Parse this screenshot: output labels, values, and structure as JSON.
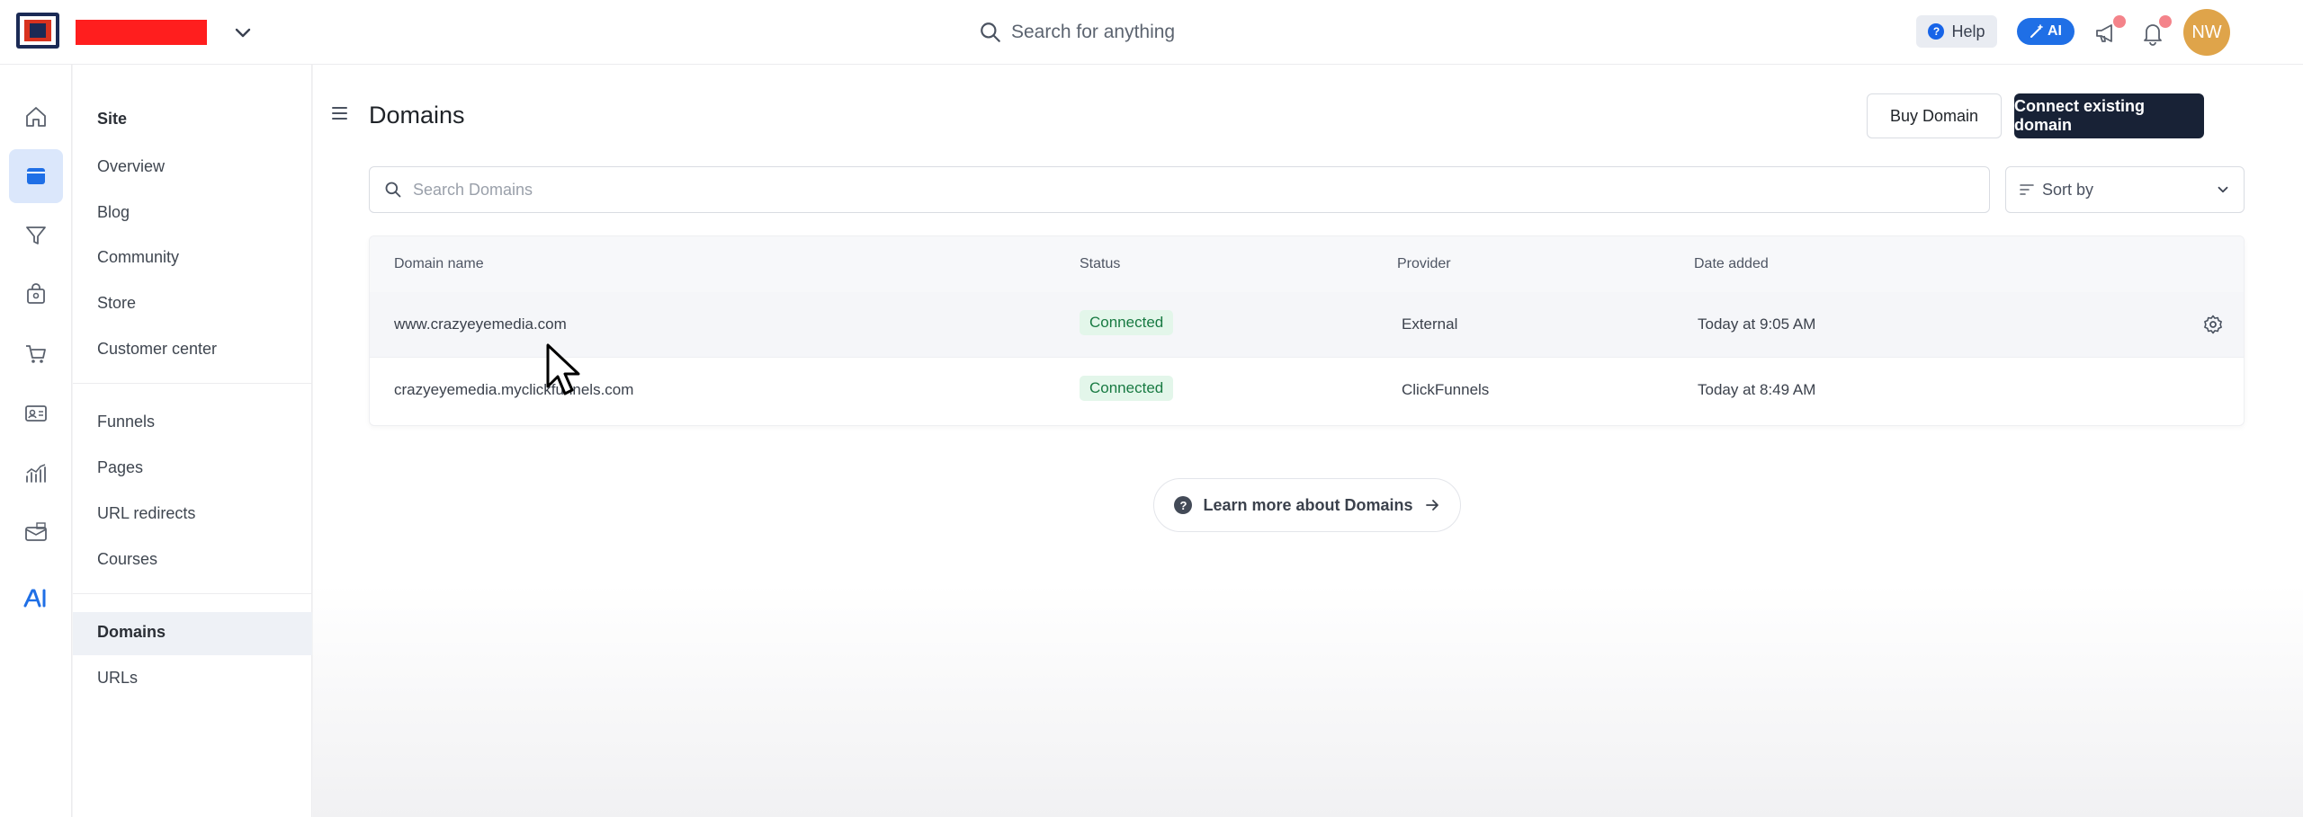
{
  "topbar": {
    "search_placeholder": "Search for anything",
    "help_label": "Help",
    "help_icon": "?",
    "ai_label": "AI",
    "avatar_initials": "NW"
  },
  "rail": {
    "icons": [
      "home-icon",
      "websites-icon",
      "funnel-icon",
      "store-icon",
      "cart-icon",
      "contacts-icon",
      "analytics-icon",
      "email-icon",
      "ai-icon"
    ],
    "active": "websites-icon",
    "accent_color": "#1f6fe6"
  },
  "subnav": {
    "heading": "Site",
    "group1": [
      "Overview",
      "Blog",
      "Community",
      "Store",
      "Customer center"
    ],
    "group2": [
      "Funnels",
      "Pages",
      "URL redirects",
      "Courses"
    ],
    "group3": [
      "Domains",
      "URLs"
    ],
    "active": "Domains"
  },
  "main": {
    "title": "Domains",
    "buy_button": "Buy Domain",
    "connect_button": "Connect existing domain",
    "search_placeholder": "Search Domains",
    "sort_label": "Sort by",
    "columns": [
      "Domain name",
      "Status",
      "Provider",
      "Date added"
    ],
    "rows": [
      {
        "domain": "www.crazyeyemedia.com",
        "status": "Connected",
        "provider": "External",
        "date": "Today at 9:05 AM"
      },
      {
        "domain": "crazyeyemedia.myclickfunnels.com",
        "status": "Connected",
        "provider": "ClickFunnels",
        "date": "Today at 8:49 AM"
      }
    ],
    "learn_more": "Learn more about Domains",
    "learn_icon": "?",
    "status_color": "#187a42"
  }
}
